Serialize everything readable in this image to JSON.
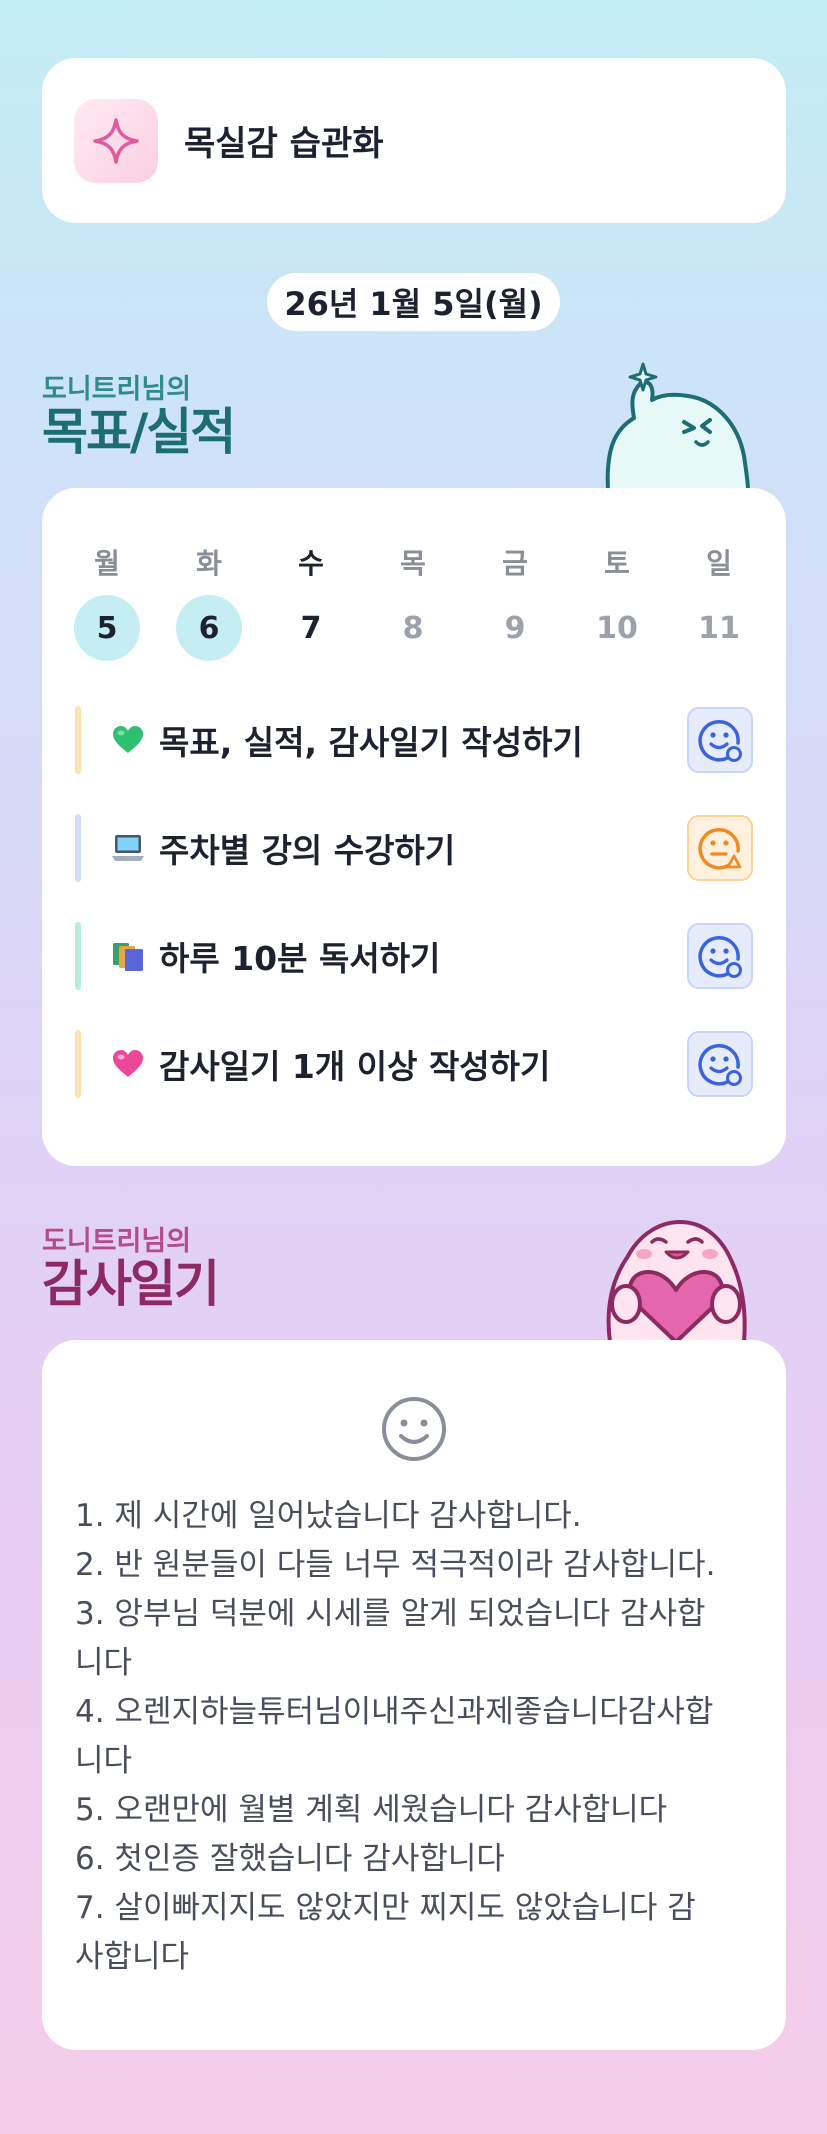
{
  "header": {
    "title": "목실감 습관화",
    "icon": "sparkle-icon",
    "accent": "#e05a9c"
  },
  "date": "26년 1월 5일(월)",
  "goals_section": {
    "subtitle": "도니트리님의",
    "title": "목표/실적"
  },
  "week": {
    "days": [
      {
        "name": "월",
        "num": "5",
        "state": "done"
      },
      {
        "name": "화",
        "num": "6",
        "state": "done"
      },
      {
        "name": "수",
        "num": "7",
        "state": "current"
      },
      {
        "name": "목",
        "num": "8",
        "state": "future"
      },
      {
        "name": "금",
        "num": "9",
        "state": "future"
      },
      {
        "name": "토",
        "num": "10",
        "state": "future"
      },
      {
        "name": "일",
        "num": "11",
        "state": "future"
      }
    ]
  },
  "goals": [
    {
      "emoji": "green-heart-icon",
      "label": "목표, 실적, 감사일기 작성하기",
      "bar_color": "#fbe2b0",
      "mood": "happy-check-icon"
    },
    {
      "emoji": "laptop-icon",
      "label": "주차별 강의 수강하기",
      "bar_color": "#d3ddf7",
      "mood": "neutral-warning-icon"
    },
    {
      "emoji": "books-icon",
      "label": "하루 10분 독서하기",
      "bar_color": "#b8efd8",
      "mood": "happy-check-icon"
    },
    {
      "emoji": "pink-heart-icon",
      "label": "감사일기 1개 이상 작성하기",
      "bar_color": "#fbe2b0",
      "mood": "happy-check-icon"
    }
  ],
  "diary_section": {
    "subtitle": "도니트리님의",
    "title": "감사일기"
  },
  "diary": {
    "icon": "smile-icon",
    "entries": [
      "1. 제 시간에 일어났습니다 감사합니다.",
      "2. 반 원분들이 다들 너무 적극적이라 감사합니다.",
      "3. 앙부님 덕분에 시세를 알게 되었습니다 감사합",
      "니다",
      "4. 오렌지하늘튜터님이내주신과제좋습니다감사합",
      "니다",
      "5. 오랜만에 월별 계획 세웠습니다 감사합니다",
      "6. 첫인증 잘했습니다 감사합니다",
      "7. 살이빠지지도 않았지만 찌지도 않았습니다 감",
      "사합니다"
    ]
  }
}
